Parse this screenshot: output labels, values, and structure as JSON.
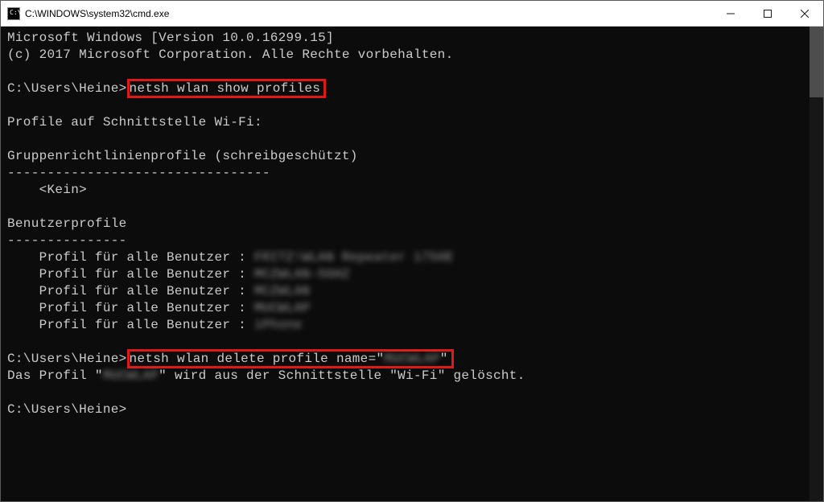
{
  "titlebar": {
    "icon_label": "C:\\",
    "title": "C:\\WINDOWS\\system32\\cmd.exe"
  },
  "terminal": {
    "banner_line1": "Microsoft Windows [Version 10.0.16299.15]",
    "banner_line2": "(c) 2017 Microsoft Corporation. Alle Rechte vorbehalten.",
    "prompt1_prefix": "C:\\Users\\Heine>",
    "cmd1": "netsh wlan show profiles",
    "section_header": "Profile auf Schnittstelle Wi-Fi:",
    "group_heading": "Gruppenrichtlinienprofile (schreibgeschützt)",
    "group_rule": "---------------------------------",
    "group_none": "    <Kein>",
    "user_heading": "Benutzerprofile",
    "user_rule": "---------------",
    "profile_label": "    Profil für alle Benutzer : ",
    "profiles": [
      "FRITZ!WLAN Repeater 1750E",
      "MCZWLAN-5GHZ",
      "MCZWLAN",
      "MUCWLAP",
      "iPhone"
    ],
    "prompt2_prefix": "C:\\Users\\Heine>",
    "cmd2_a": "netsh wlan delete profile name=\"",
    "cmd2_target": "MUCWLAP",
    "cmd2_b": "\"",
    "result_a": "Das Profil \"",
    "result_target": "MUCWLAP",
    "result_b": "\" wird aus der Schnittstelle \"Wi-Fi\" gelöscht.",
    "prompt3": "C:\\Users\\Heine>"
  }
}
